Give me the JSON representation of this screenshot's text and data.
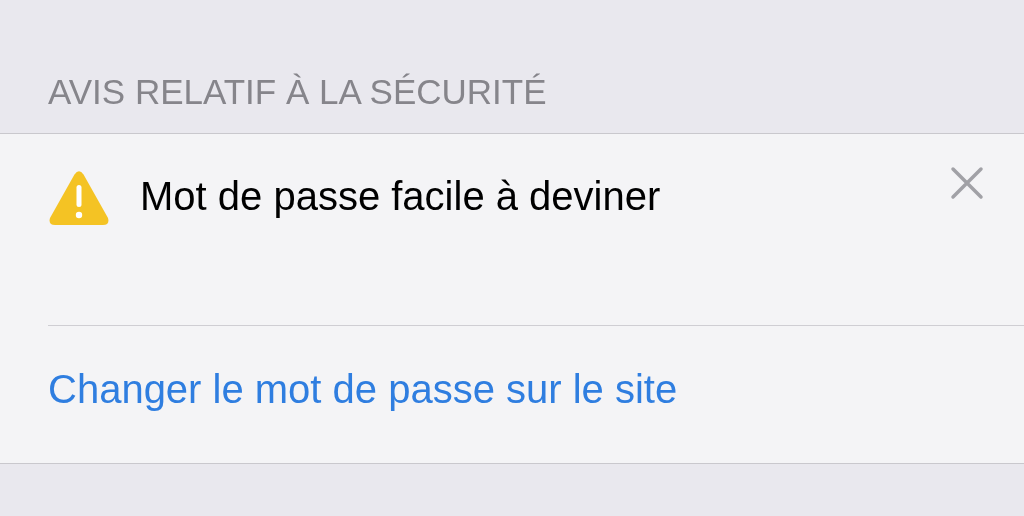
{
  "section": {
    "header": "AVIS RELATIF À LA SÉCURITÉ",
    "warning": {
      "title": "Mot de passe facile à deviner"
    },
    "action": {
      "label": "Changer le mot de passe sur le site"
    }
  }
}
